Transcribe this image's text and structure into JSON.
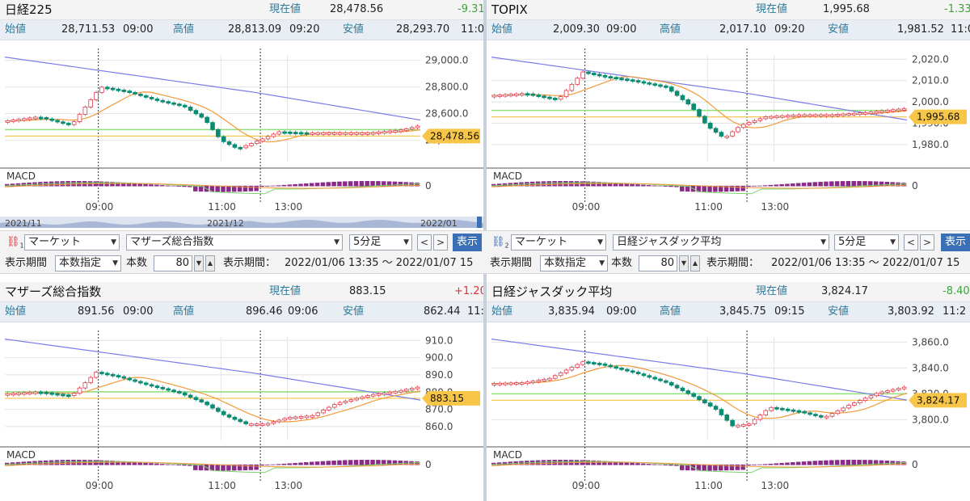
{
  "labels": {
    "current": "現在値",
    "open": "始値",
    "high": "高値",
    "low": "安値",
    "macd": "MACD"
  },
  "colors": {
    "up": "#e03a4a",
    "down": "#0a8b72",
    "ma_blue": "#7b7bea",
    "ma_orange": "#f29a3a",
    "ref_green": "#8fe07a",
    "ref_yellow": "#f5c85a",
    "tag": "#f7c548"
  },
  "panels": [
    {
      "title": "日経225",
      "current": "28,478.56",
      "change": "-9.31",
      "direction": "down",
      "open": "28,711.53",
      "open_time": "09:00",
      "high": "28,813.09",
      "high_time": "09:20",
      "low": "28,293.70",
      "low_time": "11:0",
      "price_ticks": [
        "29,000.0",
        "28,800.0",
        "28,600.0",
        "28,400.0"
      ],
      "time_ticks": [
        "09:00",
        "11:00",
        "13:00"
      ],
      "price_tag": "28,478.56",
      "nav_labels": [
        "2021/11",
        "2021/12",
        "2022/01"
      ]
    },
    {
      "title": "TOPIX",
      "current": "1,995.68",
      "change": "-1.33",
      "direction": "down",
      "open": "2,009.30",
      "open_time": "09:00",
      "high": "2,017.10",
      "high_time": "09:20",
      "low": "1,981.52",
      "low_time": "11:0",
      "price_ticks": [
        "2,020.0",
        "2,010.0",
        "2,000.0",
        "1,990.0",
        "1,980.0"
      ],
      "time_ticks": [
        "09:00",
        "11:00",
        "13:00"
      ],
      "price_tag": "1,995.68",
      "nav_labels": []
    },
    {
      "title": "マザーズ総合指数",
      "current": "883.15",
      "change": "+1.20",
      "direction": "up",
      "open": "891.56",
      "open_time": "09:00",
      "high": "896.46",
      "high_time": "09:06",
      "low": "862.44",
      "low_time": "11:0",
      "price_ticks": [
        "910.0",
        "900.0",
        "890.0",
        "880.0",
        "870.0",
        "860.0"
      ],
      "time_ticks": [
        "09:00",
        "11:00",
        "13:00"
      ],
      "price_tag": "883.15",
      "nav_labels": []
    },
    {
      "title": "日経ジャスダック平均",
      "current": "3,824.17",
      "change": "-8.40",
      "direction": "down",
      "open": "3,835.94",
      "open_time": "09:00",
      "high": "3,845.75",
      "high_time": "09:15",
      "low": "3,803.92",
      "low_time": "11:2",
      "price_ticks": [
        "3,860.0",
        "3,840.0",
        "3,820.0",
        "3,800.0"
      ],
      "time_ticks": [
        "09:00",
        "11:00",
        "13:00"
      ],
      "price_tag": "3,824.17",
      "nav_labels": []
    }
  ],
  "controls": [
    {
      "link_num": "1",
      "market": "マーケット",
      "index": "マザーズ総合指数",
      "interval": "5分足",
      "prev": "<",
      "next": ">",
      "show": "表示",
      "period_label": "表示期間",
      "period_mode": "本数指定",
      "count_label": "本数",
      "count": "80",
      "range_label": "表示期間：",
      "range": "2022/01/06 13:35 ～ 2022/01/07 15"
    },
    {
      "link_num": "2",
      "market": "マーケット",
      "index": "日経ジャスダック平均",
      "interval": "5分足",
      "prev": "<",
      "next": ">",
      "show": "表示",
      "period_label": "表示期間",
      "period_mode": "本数指定",
      "count_label": "本数",
      "count": "80",
      "range_label": "表示期間：",
      "range": "2022/01/06 13:35 ～ 2022/01/07 15"
    }
  ]
}
